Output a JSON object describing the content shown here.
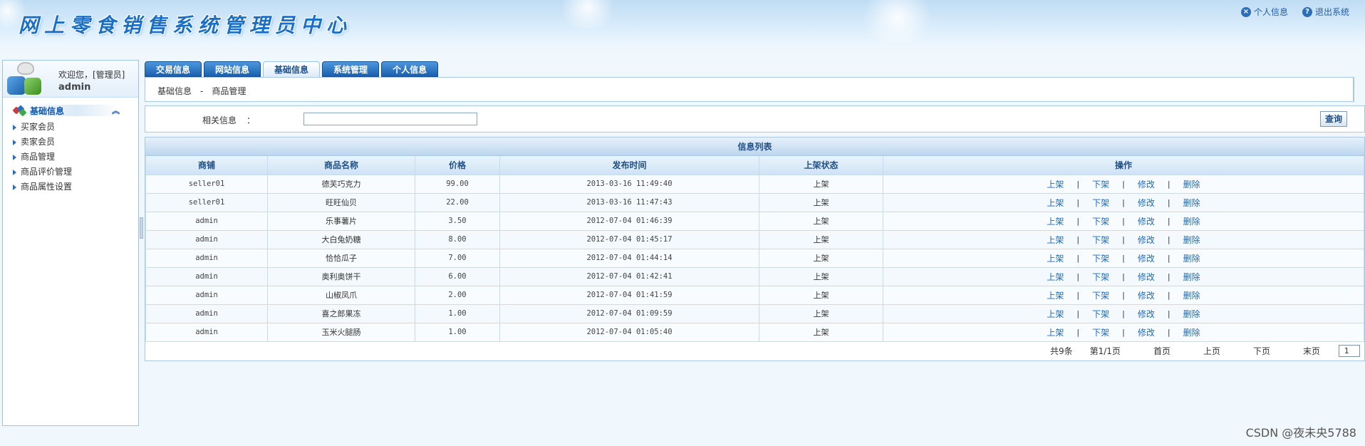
{
  "header": {
    "title": "网上零食销售系统管理员中心",
    "links": [
      {
        "label": "个人信息",
        "icon": "x-circle-icon"
      },
      {
        "label": "退出系统",
        "icon": "help-circle-icon"
      }
    ]
  },
  "sidebar": {
    "welcome": "欢迎您，[管理员]",
    "username": "admin",
    "section_title": "基础信息",
    "collapse_glyph": "︽",
    "items": [
      {
        "label": "买家会员"
      },
      {
        "label": "卖家会员"
      },
      {
        "label": "商品管理"
      },
      {
        "label": "商品评价管理"
      },
      {
        "label": "商品属性设置"
      }
    ]
  },
  "tabs": [
    {
      "label": "交易信息",
      "active": false
    },
    {
      "label": "网站信息",
      "active": false
    },
    {
      "label": "基础信息",
      "active": true
    },
    {
      "label": "系统管理",
      "active": false
    },
    {
      "label": "个人信息",
      "active": false
    }
  ],
  "breadcrumb": {
    "parent": "基础信息",
    "separator": "-",
    "current": "商品管理"
  },
  "search": {
    "label": "相关信息",
    "colon": "：",
    "value": "",
    "button": "查询"
  },
  "list": {
    "title": "信息列表",
    "columns": [
      "商铺",
      "商品名称",
      "价格",
      "发布时间",
      "上架状态",
      "操作"
    ],
    "rows": [
      {
        "shop": "seller01",
        "name": "德芙巧克力",
        "price": "99.00",
        "time": "2013-03-16 11:49:40",
        "status": "上架"
      },
      {
        "shop": "seller01",
        "name": "旺旺仙贝",
        "price": "22.00",
        "time": "2013-03-16 11:47:43",
        "status": "上架"
      },
      {
        "shop": "admin",
        "name": "乐事薯片",
        "price": "3.50",
        "time": "2012-07-04 01:46:39",
        "status": "上架"
      },
      {
        "shop": "admin",
        "name": "大白兔奶糖",
        "price": "8.00",
        "time": "2012-07-04 01:45:17",
        "status": "上架"
      },
      {
        "shop": "admin",
        "name": "恰恰瓜子",
        "price": "7.00",
        "time": "2012-07-04 01:44:14",
        "status": "上架"
      },
      {
        "shop": "admin",
        "name": "奥利奥饼干",
        "price": "6.00",
        "time": "2012-07-04 01:42:41",
        "status": "上架"
      },
      {
        "shop": "admin",
        "name": "山椒凤爪",
        "price": "2.00",
        "time": "2012-07-04 01:41:59",
        "status": "上架"
      },
      {
        "shop": "admin",
        "name": "喜之郎果冻",
        "price": "1.00",
        "time": "2012-07-04 01:09:59",
        "status": "上架"
      },
      {
        "shop": "admin",
        "name": "玉米火腿肠",
        "price": "1.00",
        "time": "2012-07-04 01:05:40",
        "status": "上架"
      }
    ],
    "actions": [
      "上架",
      "下架",
      "修改",
      "删除"
    ],
    "action_separator": "|"
  },
  "pager": {
    "total": "共9条",
    "page": "第1/1页",
    "first": "首页",
    "prev": "上页",
    "next": "下页",
    "last": "末页",
    "select_value": "1"
  },
  "watermark": "CSDN @夜未央5788",
  "colors": {
    "accent": "#1a5fae",
    "link": "#1e6ab8",
    "border": "#a8c8e5"
  }
}
